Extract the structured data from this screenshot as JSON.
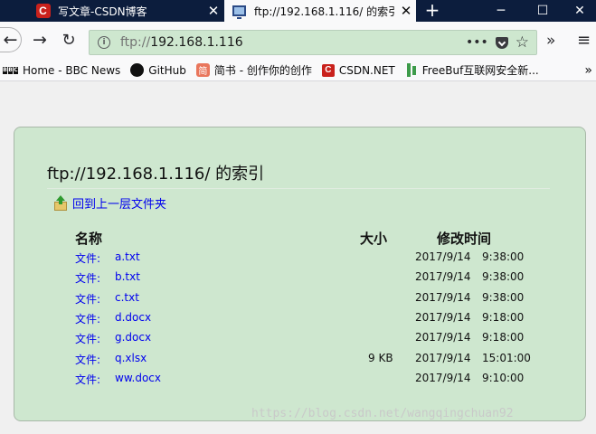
{
  "tabs": [
    {
      "title": "写文章-CSDN博客",
      "favicon": "csdn-icon",
      "active": false
    },
    {
      "title": "ftp://192.168.1.116/ 的索引",
      "favicon": "monitor-icon",
      "active": true
    }
  ],
  "tab_close": "✕",
  "new_tab": "+",
  "window": {
    "minimize": "─",
    "maximize": "☐",
    "close": "✕"
  },
  "nav": {
    "back": "←",
    "forward": "→",
    "reload": "↻",
    "overflow": "»",
    "menu": "≡",
    "page_actions": "•••",
    "bookmark_star": "☆"
  },
  "url": {
    "protocol": "ftp://",
    "host": "192.168.1.116"
  },
  "bookmarks": [
    {
      "label": "Home - BBC News",
      "icon": "bbc-icon"
    },
    {
      "label": "GitHub",
      "icon": "github-icon"
    },
    {
      "label": "简书 - 创作你的创作",
      "icon": "jianshu-icon"
    },
    {
      "label": "CSDN.NET",
      "icon": "csdn-icon"
    },
    {
      "label": "FreeBuf互联网安全新...",
      "icon": "freebuf-icon"
    }
  ],
  "bookmarks_more": "»",
  "page": {
    "heading": "ftp://192.168.1.116/ 的索引",
    "up_link": "回到上一层文件夹",
    "columns": {
      "name": "名称",
      "size": "大小",
      "modified": "修改时间"
    },
    "files": [
      {
        "type": "文件:",
        "name": "a.txt",
        "size": "",
        "date": "2017/9/14",
        "time": "9:38:00"
      },
      {
        "type": "文件:",
        "name": "b.txt",
        "size": "",
        "date": "2017/9/14",
        "time": "9:38:00"
      },
      {
        "type": "文件:",
        "name": "c.txt",
        "size": "",
        "date": "2017/9/14",
        "time": "9:38:00"
      },
      {
        "type": "文件:",
        "name": "d.docx",
        "size": "",
        "date": "2017/9/14",
        "time": "9:18:00"
      },
      {
        "type": "文件:",
        "name": "g.docx",
        "size": "",
        "date": "2017/9/14",
        "time": "9:18:00"
      },
      {
        "type": "文件:",
        "name": "q.xlsx",
        "size": "9 KB",
        "date": "2017/9/14",
        "time": "15:01:00"
      },
      {
        "type": "文件:",
        "name": "ww.docx",
        "size": "",
        "date": "2017/9/14",
        "time": "9:10:00"
      }
    ]
  },
  "watermark": "https://blog.csdn.net/wangqingchuan92",
  "colors": {
    "titlebar": "#0c1d3d",
    "urlbar": "#cee7cf",
    "panel": "#cee7cf",
    "link": "#0000ee",
    "csdn": "#c9211c"
  }
}
